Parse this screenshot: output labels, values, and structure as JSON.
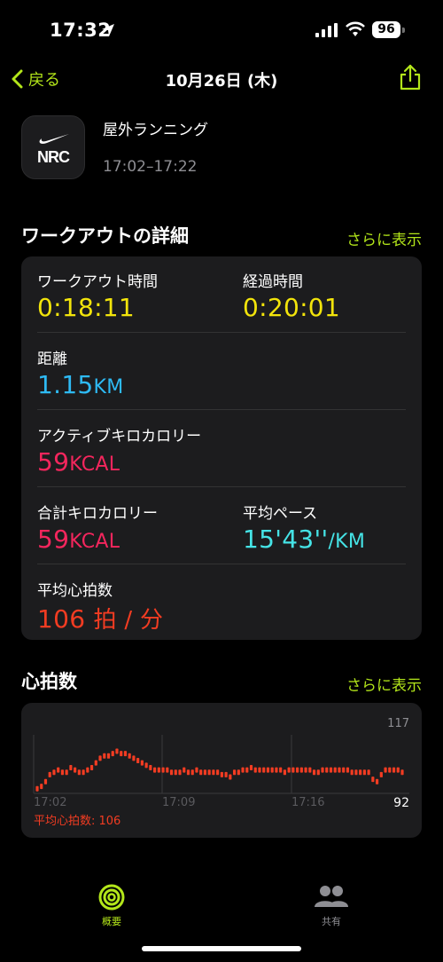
{
  "status": {
    "time": "17:32",
    "battery": "96"
  },
  "nav": {
    "back_label": "戻る",
    "title": "10月26日 (木)"
  },
  "workout": {
    "app_logo_text": "NRC",
    "name": "屋外ランニング",
    "time_range": "17:02–17:22"
  },
  "details": {
    "title": "ワークアウトの詳細",
    "more": "さらに表示",
    "workout_time_label": "ワークアウト時間",
    "workout_time_value": "0:18:11",
    "elapsed_label": "経過時間",
    "elapsed_value": "0:20:01",
    "distance_label": "距離",
    "distance_value": "1.15",
    "distance_unit": "KM",
    "active_kcal_label": "アクティブキロカロリー",
    "active_kcal_value": "59",
    "active_kcal_unit": "KCAL",
    "total_kcal_label": "合計キロカロリー",
    "total_kcal_value": "59",
    "total_kcal_unit": "KCAL",
    "pace_label": "平均ペース",
    "pace_value": "15'43''",
    "pace_unit": "/KM",
    "avg_hr_label": "平均心拍数",
    "avg_hr_value": "106",
    "avg_hr_unit": "拍 / 分"
  },
  "heart": {
    "title": "心拍数",
    "more": "さらに表示",
    "avg_label": "平均心拍数: 106"
  },
  "chart_data": {
    "type": "scatter",
    "x_ticks": [
      "17:02",
      "17:09",
      "17:16"
    ],
    "y_max_label": "117",
    "y_min_label": "92",
    "ylim": [
      92,
      117
    ],
    "values": [
      94,
      95,
      97,
      100,
      101,
      102,
      101,
      101,
      103,
      102,
      101,
      101,
      102,
      103,
      105,
      107,
      108,
      108,
      109,
      110,
      109,
      109,
      108,
      107,
      106,
      105,
      104,
      103,
      102,
      102,
      102,
      102,
      101,
      101,
      101,
      102,
      101,
      101,
      102,
      101,
      101,
      101,
      101,
      101,
      100,
      100,
      99,
      101,
      101,
      102,
      102,
      103,
      102,
      102,
      102,
      102,
      102,
      102,
      102,
      101,
      102,
      102,
      102,
      102,
      102,
      102,
      101,
      101,
      102,
      102,
      102,
      102,
      102,
      102,
      102,
      101,
      101,
      101,
      101,
      101,
      98,
      97,
      100,
      102,
      102,
      102,
      102,
      101
    ]
  },
  "tabs": {
    "summary": "概要",
    "sharing": "共有"
  },
  "colors": {
    "accent": "#b3e61a",
    "yellow": "#f2e40b",
    "blue": "#2ebaf4",
    "pink": "#f4265d",
    "cyan": "#45e3e6",
    "heart": "#f23c22"
  }
}
